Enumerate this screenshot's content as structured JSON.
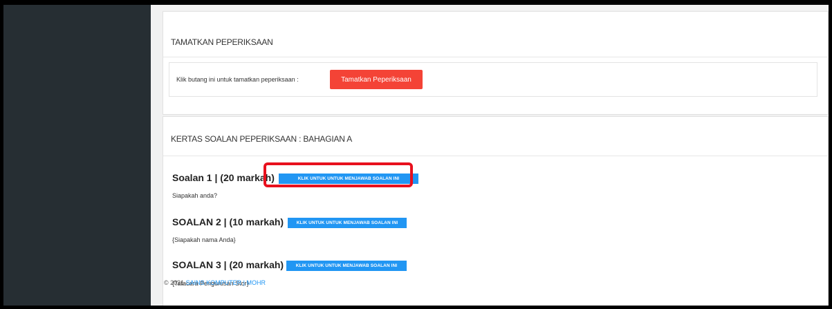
{
  "section_end": {
    "title": "TAMATKAN PEPERIKSAAN",
    "instruction": "Klik butang ini untuk tamatkan peperiksaan :",
    "button_label": "Tamatkan Peperiksaan"
  },
  "section_questions": {
    "title": "KERTAS SOALAN PEPERIKSAAN : BAHAGIAN A",
    "questions": [
      {
        "heading": "Soalan 1 | (20 markah)",
        "button_label": "KLIK UNTUK UNTUK MENJAWAB SOALAN INI",
        "text": "Siapakah anda?"
      },
      {
        "heading": "SOALAN 2 | (10 markah)",
        "button_label": "KLIK UNTUK UNTUK MENJAWAB SOALAN INI",
        "text": "{Siapakah nama Anda}"
      },
      {
        "heading": "SOALAN 3 | (20 markah)",
        "button_label": "KLIK UNTUK UNTUK MENJAWAB SOALAN INI",
        "text": "{Tatacara Pengurusan Stor}"
      }
    ]
  },
  "footer": {
    "copyright": "© 2021",
    "link": "SAINS KOMPUTER | MOHR"
  },
  "colors": {
    "sidebar": "#262e33",
    "danger": "#f44336",
    "primary": "#2196f3",
    "highlight": "#e8101d"
  }
}
